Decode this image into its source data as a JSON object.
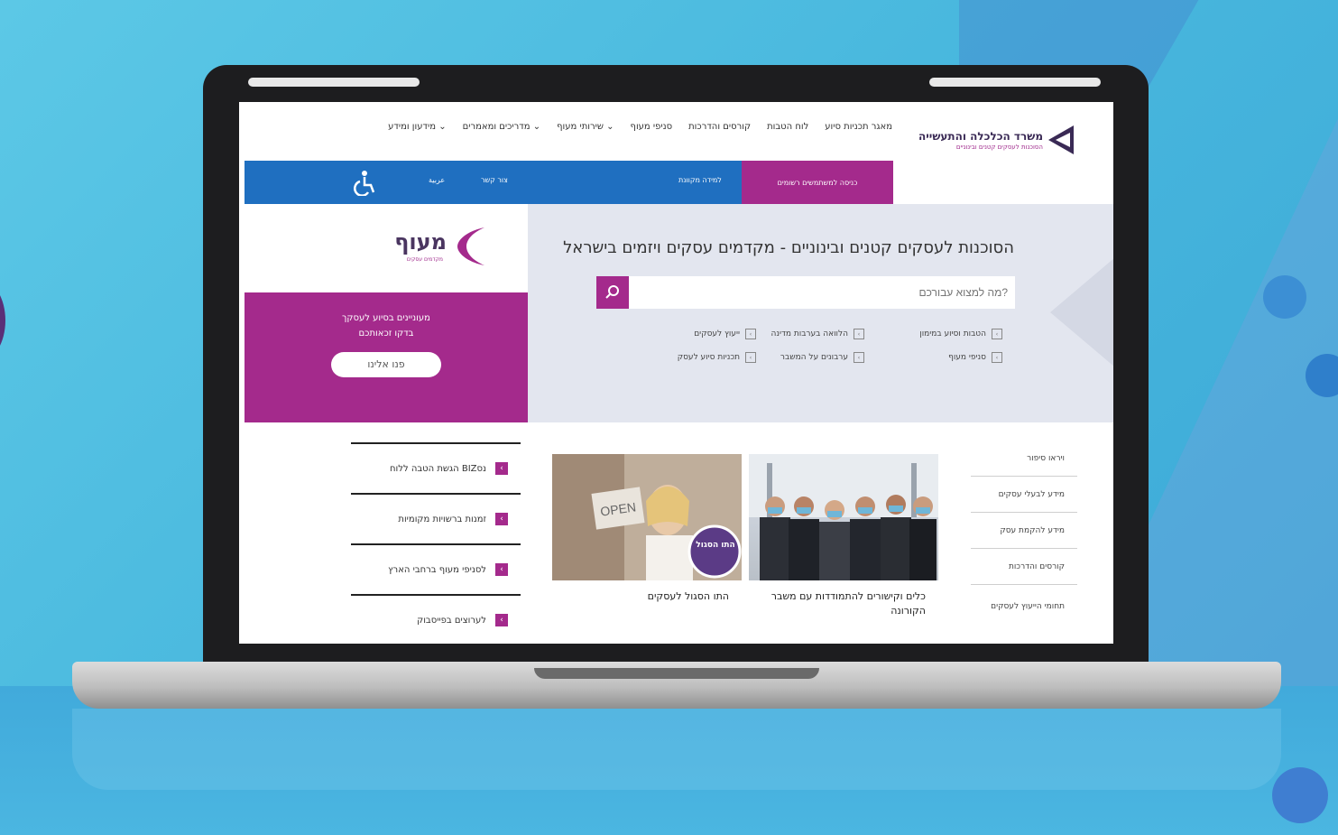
{
  "site": {
    "ministry_name": "משרד הכלכלה והתעשייה",
    "agency_sub": "הסוכנות לעסקים קטנים ובינוניים"
  },
  "menu": [
    {
      "label": "מאגר תכניות סיוע"
    },
    {
      "label": "לוח הטבות"
    },
    {
      "label": "קורסים והדרכות"
    },
    {
      "label": "סניפי מעוף"
    },
    {
      "label": "שירותי מעוף ⌄"
    },
    {
      "label": "מדריכים ומאמרים ⌄"
    },
    {
      "label": "מידעון ומידע ⌄"
    }
  ],
  "topbar": {
    "entrepreneurs_btn": "כניסה למשתמשים רשומים",
    "tender_link": "למידה מקוונת",
    "contact_link": "צור קשר",
    "lang_link": "عربية"
  },
  "hero": {
    "title": "הסוכנות לעסקים קטנים ובינוניים - מקדמים עסקים ויזמים בישראל",
    "search_placeholder": "מה למצוא עבורכם?",
    "quick_links": [
      "הטבות וסיוע במימון",
      "הלוואה בערבות מדינה",
      "ייעוץ לעסקים",
      "סניפי מעוף",
      "ערבונים על המשבר",
      "תכניות סיוע לעסק"
    ]
  },
  "brand": {
    "name": "מעוף",
    "tagline": "מקדמים עסקים"
  },
  "promo": {
    "line1": "מעוניינים בסיוע לעסקך",
    "line2": "בדקו זכאותכם",
    "button": "פנו אלינו"
  },
  "right_nav": [
    "ויראו סיפור",
    "מידע לבעלי עסקים",
    "מידע להקמת עסק",
    "קורסים והדרכות",
    "תחומי הייעוץ לעסקים"
  ],
  "cards": [
    {
      "caption": "כלים וקישורים להתמודדות עם משבר הקורונה"
    },
    {
      "caption": "התו הסגול לעסקים",
      "badge": "התו הסגול"
    }
  ],
  "left_list": [
    "הגשת הטבה ללוח BIZנס",
    "זמנות ברשויות מקומיות",
    "לסניפי מעוף ברחבי הארץ",
    "לערוצים בפייסבוק"
  ],
  "icons": {
    "search": "search-icon",
    "accessibility": "accessibility-icon",
    "arrow": "chevron-left-icon"
  },
  "colors": {
    "brand_purple": "#a42a8c",
    "nav_blue": "#1f6fc0",
    "hero_bg": "#e3e6ef"
  }
}
